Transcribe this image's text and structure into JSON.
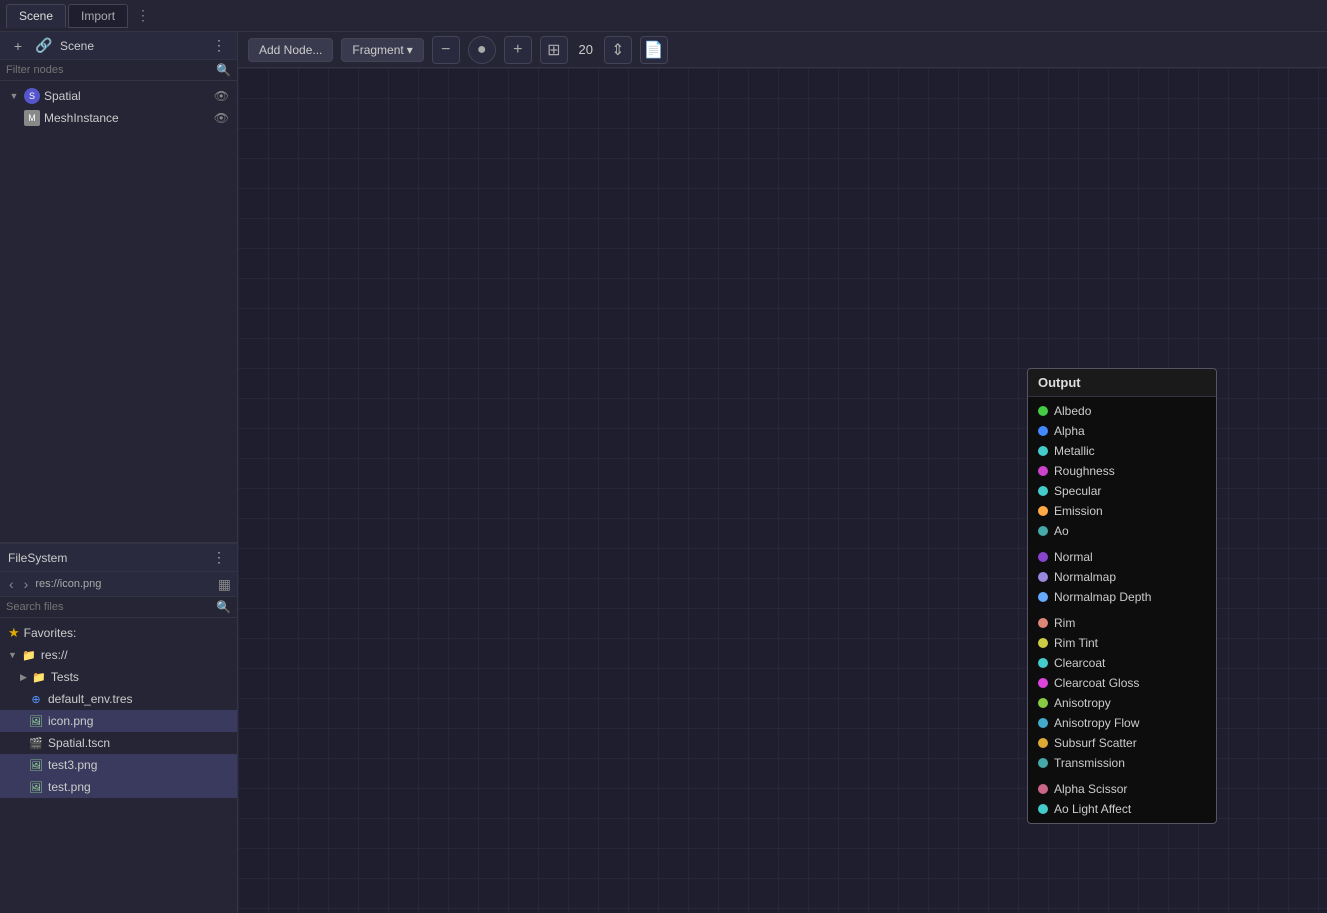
{
  "topTabs": {
    "tabs": [
      {
        "id": "scene",
        "label": "Scene",
        "active": true
      },
      {
        "id": "import",
        "label": "Import",
        "active": false
      }
    ],
    "moreIcon": "⋮"
  },
  "scenePanel": {
    "title": "Scene",
    "addIcon": "+",
    "linkIcon": "🔗",
    "moreIcon": "⋮",
    "filterPlaceholder": "Filter nodes",
    "filterSearchIcon": "🔍",
    "nodes": [
      {
        "indent": 0,
        "expanded": true,
        "type": "spatial",
        "label": "Spatial",
        "visible": true,
        "arrow": "▼"
      },
      {
        "indent": 1,
        "expanded": false,
        "type": "mesh",
        "label": "MeshInstance",
        "visible": true,
        "arrow": ""
      }
    ]
  },
  "filesystemPanel": {
    "title": "FileSystem",
    "moreIcon": "⋮",
    "navBack": "‹",
    "navForward": "›",
    "path": "res://icon.png",
    "layoutIcon": "▦",
    "searchPlaceholder": "Search files",
    "searchIcon": "🔍",
    "favoritesLabel": "Favorites:",
    "tree": [
      {
        "type": "favorites",
        "indent": 0,
        "label": "Favorites:",
        "icon": "★"
      },
      {
        "type": "folder",
        "indent": 0,
        "label": "res://",
        "icon": "▼",
        "expanded": true,
        "arrow": "▼"
      },
      {
        "type": "folder",
        "indent": 1,
        "label": "Tests",
        "icon": "▶",
        "expanded": false,
        "arrow": "▶"
      },
      {
        "type": "file-tres",
        "indent": 1,
        "label": "default_env.tres",
        "icon": "⊕"
      },
      {
        "type": "file-png",
        "indent": 1,
        "label": "icon.png",
        "icon": "🖼",
        "selected": true
      },
      {
        "type": "file-tscn",
        "indent": 1,
        "label": "Spatial.tscn",
        "icon": "🎬"
      },
      {
        "type": "file-png3",
        "indent": 1,
        "label": "test3.png",
        "icon": "🖼"
      },
      {
        "type": "file-png2",
        "indent": 1,
        "label": "test.png",
        "icon": "🖼"
      }
    ]
  },
  "nodeToolbar": {
    "addNodeLabel": "Add Node...",
    "shaderTypeLabel": "Fragment",
    "dropdownArrow": "▾",
    "zoomOutIcon": "−",
    "circleIcon": "●",
    "zoomInIcon": "+",
    "gridIcon": "⊞",
    "zoomLevel": "20",
    "arrowsIcon": "⇕",
    "fileIcon": "📄"
  },
  "outputNode": {
    "title": "Output",
    "rows": [
      {
        "dotClass": "dot-green",
        "label": "Albedo"
      },
      {
        "dotClass": "dot-blue",
        "label": "Alpha"
      },
      {
        "dotClass": "dot-cyan",
        "label": "Metallic"
      },
      {
        "dotClass": "dot-pink",
        "label": "Roughness"
      },
      {
        "dotClass": "dot-cyan",
        "label": "Specular"
      },
      {
        "dotClass": "dot-orange",
        "label": "Emission"
      },
      {
        "dotClass": "dot-teal",
        "label": "Ao"
      },
      {
        "spacer": true
      },
      {
        "dotClass": "dot-purple",
        "label": "Normal"
      },
      {
        "dotClass": "dot-lavender",
        "label": "Normalmap"
      },
      {
        "dotClass": "dot-lightblue",
        "label": "Normalmap Depth"
      },
      {
        "spacer": true
      },
      {
        "dotClass": "dot-salmon",
        "label": "Rim"
      },
      {
        "dotClass": "dot-yellow",
        "label": "Rim Tint"
      },
      {
        "dotClass": "dot-cyan",
        "label": "Clearcoat"
      },
      {
        "dotClass": "dot-magenta",
        "label": "Clearcoat Gloss"
      },
      {
        "dotClass": "dot-lime",
        "label": "Anisotropy"
      },
      {
        "dotClass": "dot-sky",
        "label": "Anisotropy Flow"
      },
      {
        "dotClass": "dot-gold",
        "label": "Subsurf Scatter"
      },
      {
        "dotClass": "dot-teal",
        "label": "Transmission"
      },
      {
        "spacer": true
      },
      {
        "dotClass": "dot-rose",
        "label": "Alpha Scissor"
      },
      {
        "dotClass": "dot-cyan",
        "label": "Ao Light Affect"
      }
    ]
  }
}
